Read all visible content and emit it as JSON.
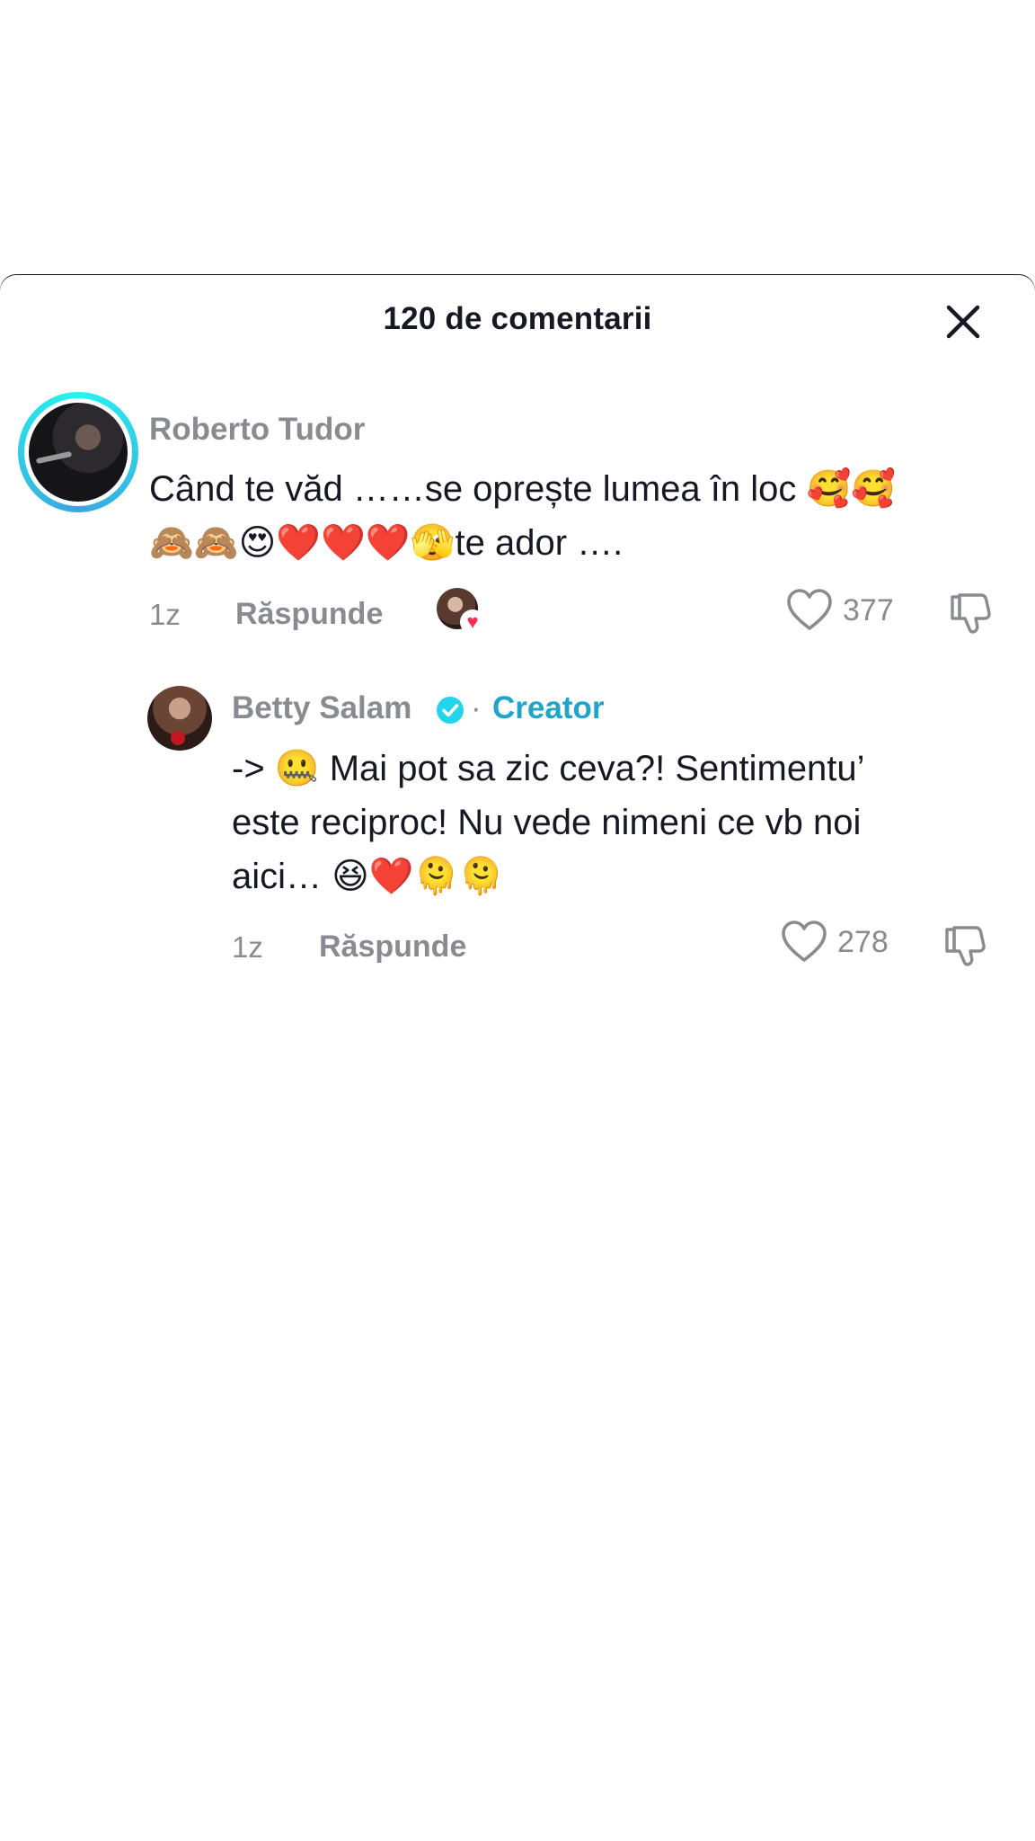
{
  "header": {
    "title": "120 de comentarii",
    "close_icon": "close-icon"
  },
  "comments": [
    {
      "username": "Roberto Tudor",
      "text_line1": "Când te văd ……se oprește lumea în loc 🥰🥰",
      "text_line2": "🙈🙈😍❤️❤️❤️🫣te ador ….",
      "time": "1z",
      "reply_label": "Răspunde",
      "likes": "377",
      "liked_by_creator": true
    },
    {
      "username": "Betty Salam",
      "verified": true,
      "separator": "·",
      "badge": "Creator",
      "text_line1": "-> 🤐 Mai pot sa zic ceva?! Sentimentu’",
      "text_line2": "este reciproc! Nu vede nimeni ce vb noi",
      "text_line3": "aici… 😆❤️🫠🫠",
      "time": "1z",
      "reply_label": "Răspunde",
      "likes": "278"
    }
  ],
  "colors": {
    "accent": "#20a4c8",
    "text": "#161823",
    "muted": "#8a8b91",
    "ring": "#25f4ee",
    "heart": "#fe2c55"
  }
}
